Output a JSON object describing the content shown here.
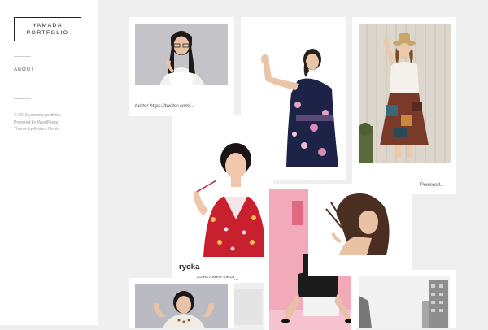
{
  "site": {
    "title_line1": "YAMADA",
    "title_line2": "PORTFOLIO"
  },
  "nav": {
    "about_label": "ABOUT"
  },
  "footer": {
    "copyright": "© 2016 yamada portfolio.",
    "powered_by": "Powered by WordPress.",
    "theme_by": "Theme by Anders Norén."
  },
  "posts": [
    {
      "caption": "twitter https://twitter.com/..."
    },
    {
      "caption": ""
    },
    {
      "caption": "Powered..."
    },
    {
      "title": "ryoka",
      "caption": "twitter https://twit..."
    },
    {
      "caption": ""
    },
    {
      "caption": ""
    },
    {
      "caption": ""
    },
    {
      "caption": ""
    }
  ],
  "colors": {
    "sidebar_bg": "#ffffff",
    "content_bg": "#efefef",
    "logo_border": "#222222"
  }
}
